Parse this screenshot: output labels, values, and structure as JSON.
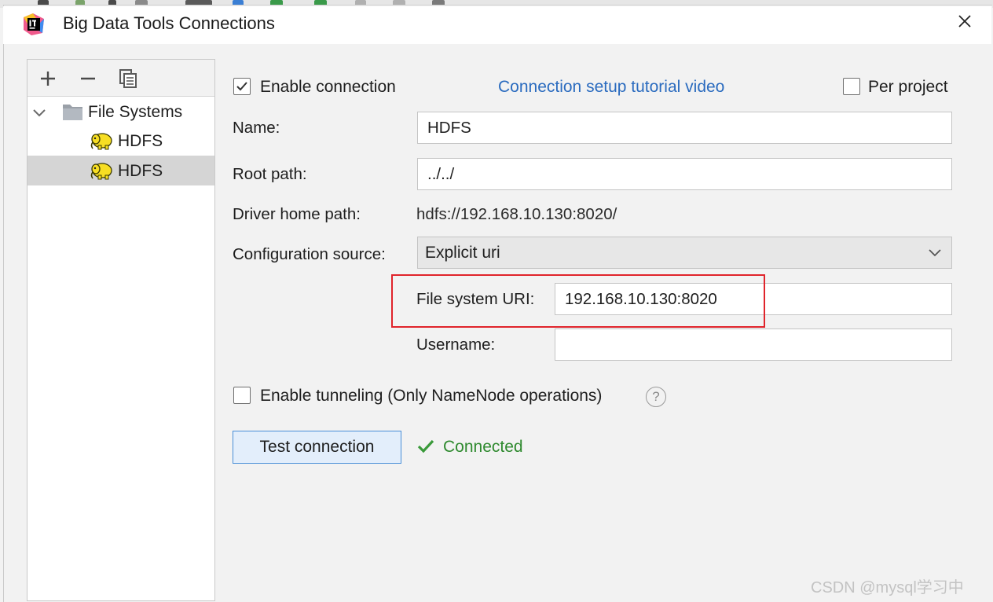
{
  "window": {
    "title": "Big Data Tools Connections"
  },
  "tree": {
    "group_label": "File Systems",
    "items": [
      {
        "label": "HDFS"
      },
      {
        "label": "HDFS"
      }
    ]
  },
  "form": {
    "enable_connection": {
      "label": "Enable connection",
      "checked": true
    },
    "tutorial_link": "Connection setup tutorial video",
    "per_project": {
      "label": "Per project",
      "checked": false
    },
    "name": {
      "label": "Name:",
      "value": "HDFS"
    },
    "root_path": {
      "label": "Root path:",
      "value": "../../"
    },
    "driver_home": {
      "label": "Driver home path:",
      "value": "hdfs://192.168.10.130:8020/"
    },
    "config_source": {
      "label": "Configuration source:",
      "value": "Explicit uri"
    },
    "fs_uri": {
      "label": "File system URI:",
      "value": "192.168.10.130:8020"
    },
    "username": {
      "label": "Username:",
      "value": ""
    },
    "tunneling": {
      "label": "Enable tunneling (Only NameNode operations)",
      "checked": false
    },
    "help_symbol": "?",
    "test_button": "Test connection",
    "status": "Connected"
  },
  "watermark": "CSDN @mysql学习中",
  "colors": {
    "accent": "#2a6bbf",
    "success": "#2f8a2f",
    "highlight": "#e0242b"
  }
}
